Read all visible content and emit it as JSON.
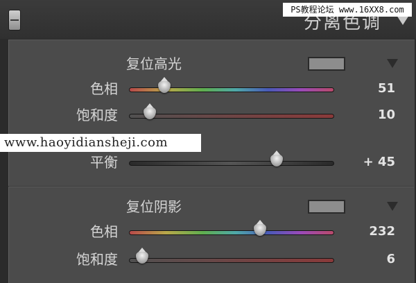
{
  "header": {
    "title": "分离色调",
    "collapse_icon": "panel-toggle-icon",
    "expand_icon": "triangle-down-icon"
  },
  "watermarks": {
    "top": "PS教程论坛 www.16XX8.com",
    "middle": "www.haoyidiansheji.com"
  },
  "highlights": {
    "title": "复位高光",
    "swatch_color": "#8d8d8d",
    "hue": {
      "label": "色相",
      "value": "51",
      "fraction": 0.17
    },
    "saturation": {
      "label": "饱和度",
      "value": "10",
      "fraction": 0.1
    }
  },
  "balance": {
    "label": "平衡",
    "value": "+ 45",
    "fraction": 0.72
  },
  "shadows": {
    "title": "复位阴影",
    "swatch_color": "#8d8d8d",
    "hue": {
      "label": "色相",
      "value": "232",
      "fraction": 0.64
    },
    "saturation": {
      "label": "饱和度",
      "value": "6",
      "fraction": 0.06
    }
  }
}
